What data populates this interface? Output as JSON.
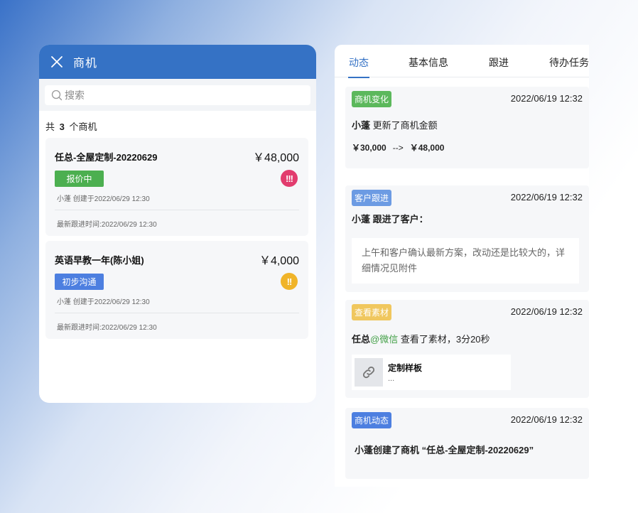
{
  "left_panel": {
    "title": "商机",
    "search_placeholder": "搜索",
    "count_prefix": "共",
    "count_number": "3",
    "count_suffix": "个商机",
    "cards": [
      {
        "name": "任总-全屋定制-20220629",
        "amount": "￥48,000",
        "status": "报价中",
        "status_color": "#4caf50",
        "priority": "!!!",
        "priority_color": "#e23c6e",
        "meta": "小蓬  创建于2022/06/29 12:30",
        "follow": "最新跟进时间:2022/06/29 12:30"
      },
      {
        "name": "英语早教一年(陈小姐)",
        "amount": "￥4,000",
        "status": "初步沟通",
        "status_color": "#4d7fe0",
        "priority": "!!",
        "priority_color": "#f0b429",
        "meta": "小蓬  创建于2022/06/29 12:30",
        "follow": "最新跟进时间:2022/06/29 12:30"
      }
    ]
  },
  "right_panel": {
    "tabs": [
      "动态",
      "基本信息",
      "跟进",
      "待办任务"
    ],
    "active_tab": "动态",
    "accent_color": "#3572c5",
    "activities": [
      {
        "tag": "商机变化",
        "tag_color": "#5cb85c",
        "time": "2022/06/19 12:32",
        "actor": "小蓬",
        "action": "更新了商机金额",
        "from_amount": "￥30,000",
        "arrow": "-->",
        "to_amount": "￥48,000"
      },
      {
        "tag": "客户跟进",
        "tag_color": "#6c9be3",
        "time": "2022/06/19 12:32",
        "actor_line": "小蓬 跟进了客户：",
        "content": "上午和客户确认最新方案，改动还是比较大的，详细情况见附件"
      },
      {
        "tag": "查看素材",
        "tag_color": "#f0c75e",
        "time": "2022/06/19 12:32",
        "actor": "任总",
        "channel": "@微信",
        "action": "查看了素材，3分20秒",
        "material_title": "定制样板",
        "material_sub": "..."
      },
      {
        "tag": "商机动态",
        "tag_color": "#4d7fe0",
        "time": "2022/06/19 12:32",
        "content": "小蓬创建了商机 “任总-全屋定制-20220629”"
      }
    ]
  }
}
